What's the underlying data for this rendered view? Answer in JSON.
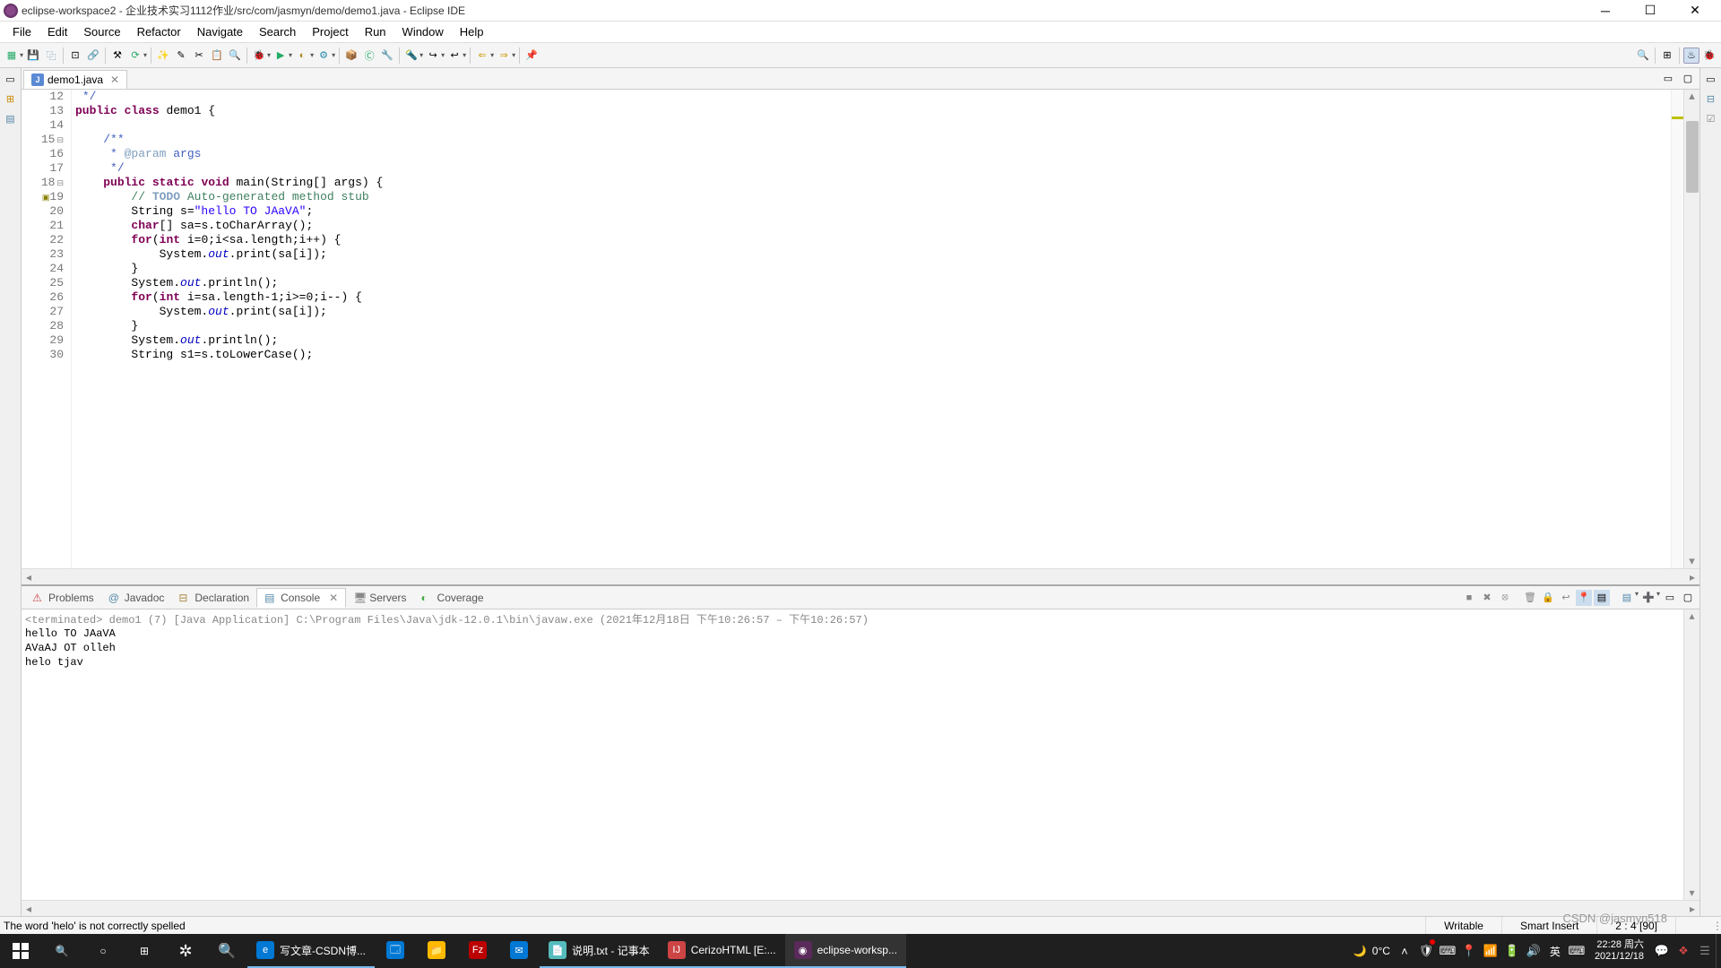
{
  "window": {
    "title": "eclipse-workspace2 - 企业技术实习1112作业/src/com/jasmyn/demo/demo1.java - Eclipse IDE"
  },
  "menu": [
    "File",
    "Edit",
    "Source",
    "Refactor",
    "Navigate",
    "Search",
    "Project",
    "Run",
    "Window",
    "Help"
  ],
  "editor": {
    "tab_label": "demo1.java",
    "lines": [
      {
        "n": 12,
        "html": " <span class='doc'>*/</span>"
      },
      {
        "n": 13,
        "html": "<span class='kw'>public</span> <span class='kw'>class</span> demo1 {"
      },
      {
        "n": 14,
        "html": ""
      },
      {
        "n": 15,
        "fold": true,
        "html": "    <span class='doc'>/**</span>"
      },
      {
        "n": 16,
        "html": "    <span class='doc'> * </span><span class='ann'>@param</span><span class='doc'> args</span>"
      },
      {
        "n": 17,
        "html": "    <span class='doc'> */</span>"
      },
      {
        "n": 18,
        "fold": true,
        "html": "    <span class='kw'>public</span> <span class='kw'>static</span> <span class='kw'>void</span> main(String[] args) {"
      },
      {
        "n": 19,
        "marker": true,
        "html": "        <span class='cmt'>// </span><span class='todo'>TODO</span><span class='cmt'> Auto-generated method stub</span>"
      },
      {
        "n": 20,
        "html": "        String s=<span class='str'>\"hello TO JAaVA\"</span>;"
      },
      {
        "n": 21,
        "html": "        <span class='kw'>char</span>[] sa=s.toCharArray();"
      },
      {
        "n": 22,
        "html": "        <span class='kw'>for</span>(<span class='kw'>int</span> i=0;i&lt;sa.length;i++) {"
      },
      {
        "n": 23,
        "html": "            System.<span class='field'>out</span>.print(sa[i]);"
      },
      {
        "n": 24,
        "html": "        }"
      },
      {
        "n": 25,
        "html": "        System.<span class='field'>out</span>.println();"
      },
      {
        "n": 26,
        "html": "        <span class='kw'>for</span>(<span class='kw'>int</span> i=sa.length-1;i&gt;=0;i--) {"
      },
      {
        "n": 27,
        "html": "            System.<span class='field'>out</span>.print(sa[i]);"
      },
      {
        "n": 28,
        "html": "        }"
      },
      {
        "n": 29,
        "html": "        System.<span class='field'>out</span>.println();"
      },
      {
        "n": 30,
        "html": "        String s1=s.toLowerCase();"
      }
    ]
  },
  "bottom_tabs": [
    "Problems",
    "Javadoc",
    "Declaration",
    "Console",
    "Servers",
    "Coverage"
  ],
  "console": {
    "header": "<terminated> demo1 (7) [Java Application] C:\\Program Files\\Java\\jdk-12.0.1\\bin\\javaw.exe  (2021年12月18日 下午10:26:57 – 下午10:26:57)",
    "output": [
      "hello TO JAaVA",
      "AVaAJ OT olleh",
      "helo tjav"
    ]
  },
  "status": {
    "message": "The word 'helo' is not correctly spelled",
    "writable": "Writable",
    "insert": "Smart Insert",
    "position": "2 : 4 [90]"
  },
  "taskbar": {
    "apps": [
      {
        "label": "写文章-CSDN博...",
        "color": "#0078d4",
        "icon": "e"
      },
      {
        "label": "",
        "color": "#0078d4",
        "icon": "🗔",
        "inactive": true
      },
      {
        "label": "",
        "color": "#ffb900",
        "icon": "📁",
        "inactive": true
      },
      {
        "label": "",
        "color": "#b00",
        "icon": "Fz",
        "inactive": true
      },
      {
        "label": "",
        "color": "#0078d4",
        "icon": "✉",
        "inactive": true
      },
      {
        "label": "说明.txt - 记事本",
        "color": "#5bb",
        "icon": "📄"
      },
      {
        "label": "CerizoHTML [E:...",
        "color": "#c44",
        "icon": "IJ"
      },
      {
        "label": "eclipse-worksp...",
        "color": "#5a2a5a",
        "icon": "◉",
        "active": true
      }
    ],
    "weather": "0°C",
    "time": "22:28",
    "day": "周六",
    "date": "2021/12/18",
    "watermark": "CSDN @jasmyn518"
  }
}
